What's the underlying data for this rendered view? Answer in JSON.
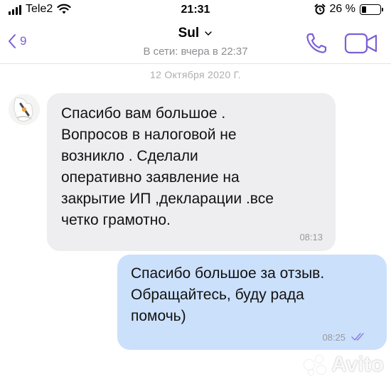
{
  "status_bar": {
    "carrier": "Tele2",
    "time": "21:31",
    "battery_percent": "26 %",
    "battery_level": 0.26
  },
  "header": {
    "back_count": "9",
    "contact_name": "Sul",
    "contact_status": "В сети: вчера в 22:37"
  },
  "chat": {
    "date_label": "12 Октября 2020 Г.",
    "messages": [
      {
        "direction": "incoming",
        "text": "Спасибо вам большое .\nВопросов в налоговой не\nвозникло . Сделали\nоперативно   заявление на\nзакрытие ИП ,декларации .все\nчетко грамотно.",
        "time": "08:13"
      },
      {
        "direction": "outgoing",
        "text": "Спасибо большое за отзыв.\nОбращайтесь, буду рада\nпомочь)",
        "time": "08:25"
      }
    ]
  },
  "watermark": {
    "text": "Avito"
  },
  "colors": {
    "accent": "#7c5fd6",
    "incoming_bubble": "#eeeef0",
    "outgoing_bubble": "#cbe0fb",
    "secondary_text": "#8e8e93"
  },
  "icons": {
    "signal": "signal-bars-icon",
    "wifi": "wifi-icon",
    "alarm": "alarm-clock-icon",
    "battery": "battery-icon",
    "back": "chevron-left-icon",
    "dropdown": "chevron-down-icon",
    "call": "phone-icon",
    "video": "video-camera-icon",
    "read": "double-check-icon"
  }
}
